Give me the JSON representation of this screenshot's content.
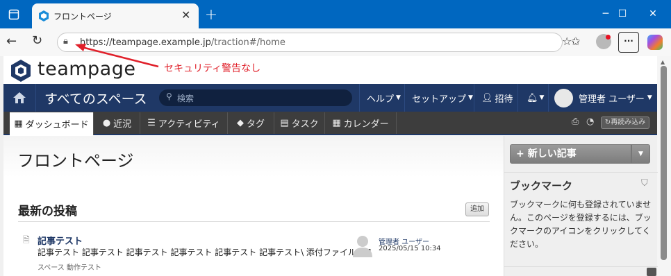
{
  "browser": {
    "tab_title": "フロントページ",
    "url_host": "https://teampage.example.jp",
    "url_path": "/traction#/home"
  },
  "annotation": {
    "text": "セキュリティ警告なし",
    "color": "#e0202a"
  },
  "app": {
    "logo_text": "teampage",
    "brand_color": "#1f3866",
    "nav": {
      "space_title": "すべてのスペース",
      "search_placeholder": "検索",
      "help": "ヘルプ",
      "setup": "セットアップ",
      "invite": "招待",
      "user": "管理者 ユーザー"
    },
    "tabs": [
      "ダッシュボード",
      "近況",
      "アクティビティ",
      "タグ",
      "タスク",
      "カレンダー"
    ],
    "reload_label": "再読み込み",
    "page_title": "フロントページ",
    "section_title": "最新の投稿",
    "add_label": "追加",
    "post": {
      "title": "記事テスト",
      "body": "記事テスト 記事テスト 記事テスト 記事テスト 記事テスト 記事テスト\\ 添付ファイル @1",
      "meta": "スペース 動作テスト",
      "author": "管理者 ユーザー",
      "date": "2025/05/15 10:34"
    },
    "sidebar": {
      "new_article": "新しい記事",
      "bookmark_title": "ブックマーク",
      "bookmark_text": "ブックマークに何も登録されていません。このページを登録するには、ブックマークのアイコンをクリックしてください。"
    }
  }
}
